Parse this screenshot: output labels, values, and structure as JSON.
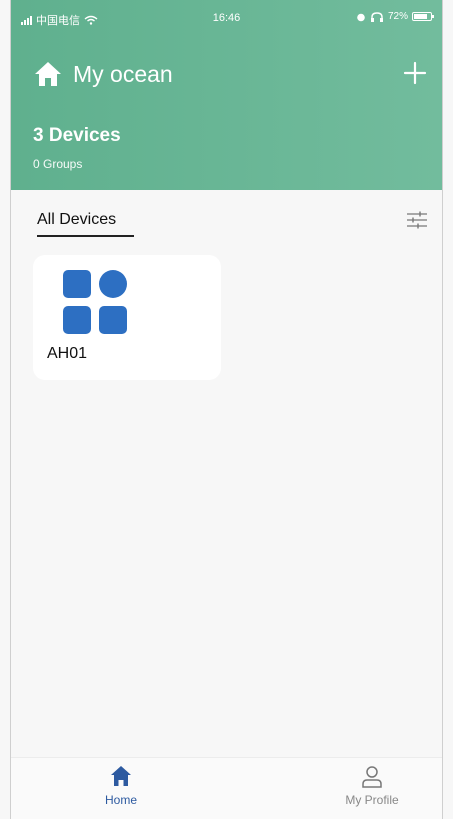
{
  "status_bar": {
    "carrier": "中国电信",
    "time": "16:46",
    "battery": "72%"
  },
  "header": {
    "title": "My ocean",
    "devices_count": "3 Devices",
    "groups_count": "0 Groups"
  },
  "tabs": {
    "all_devices": "All Devices"
  },
  "devices": [
    {
      "name": "AH01",
      "icon": "grid-app-icon"
    }
  ],
  "tabbar": {
    "home": "Home",
    "profile": "My Profile"
  },
  "colors": {
    "header_bg": "#6cb897",
    "device_icon": "#2d6fc2",
    "active_tab": "#2d5aa0"
  }
}
